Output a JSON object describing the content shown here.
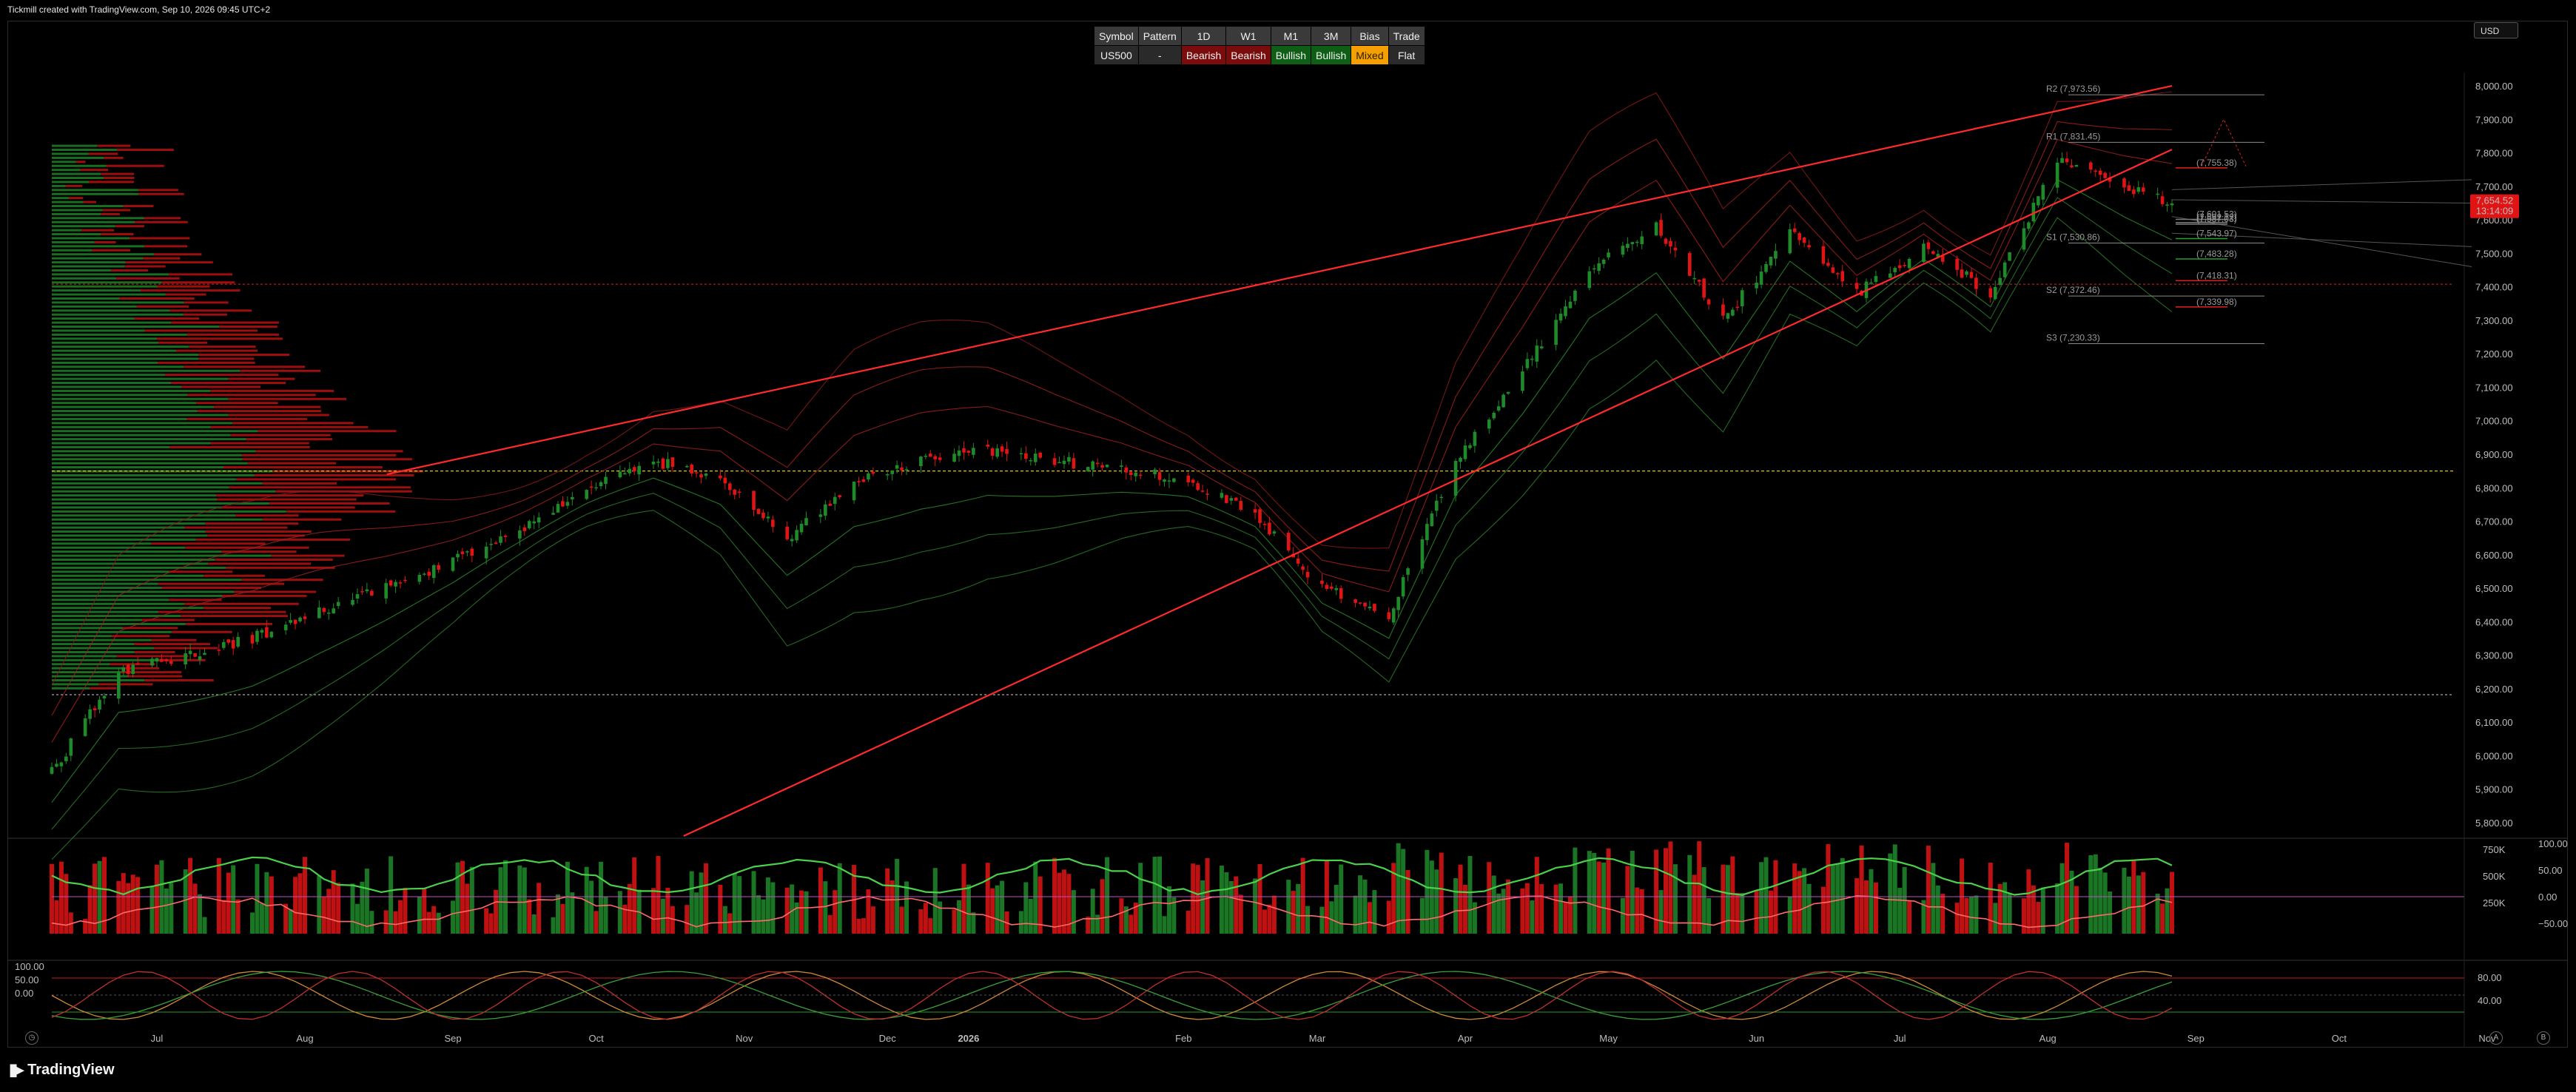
{
  "caption": "Tickmill created with TradingView.com, Sep 10, 2026 09:45 UTC+2",
  "currency": "USD",
  "brand": "TradingView",
  "bias_table": {
    "headers": [
      "Symbol",
      "Pattern",
      "1D",
      "W1",
      "M1",
      "3M",
      "Bias",
      "Trade"
    ],
    "values": [
      "US500",
      "-",
      "Bearish",
      "Bearish",
      "Bullish",
      "Bullish",
      "Mixed",
      "Flat"
    ]
  },
  "colors": {
    "up": "#1f8a2a",
    "down": "#e01414",
    "mixed": "#f5a000",
    "bearish_cell": "#7a0c0c",
    "bullish_cell": "#0e5e16",
    "wedge": "#ff2a2a"
  },
  "chart_data": [
    {
      "type": "candlestick",
      "title": "",
      "ylim": [
        5760,
        8040
      ],
      "y_ticks": [
        "8,000.00",
        "7,900.00",
        "7,800.00",
        "7,700.00",
        "7,600.00",
        "7,500.00",
        "7,400.00",
        "7,300.00",
        "7,200.00",
        "7,100.00",
        "7,000.00",
        "6,900.00",
        "6,800.00",
        "6,700.00",
        "6,600.00",
        "6,500.00",
        "6,400.00",
        "6,300.00",
        "6,200.00",
        "6,100.00",
        "6,000.00",
        "5,900.00",
        "5,800.00"
      ],
      "x_ticks": [
        "Jul",
        "Aug",
        "Sep",
        "Oct",
        "Nov",
        "Dec",
        "2026",
        "Feb",
        "Mar",
        "Apr",
        "May",
        "Jun",
        "Jul",
        "Aug",
        "Sep",
        "Oct",
        "Nov"
      ],
      "price_label": "7,654.52",
      "countdown_label": "13:14:09",
      "pivots": [
        {
          "label": "R2 (7,973.56)",
          "value": 7973.56
        },
        {
          "label": "R1 (7,831.45)",
          "value": 7831.45
        },
        {
          "label": "S1 (7,530.86)",
          "value": 7530.86
        },
        {
          "label": "S2 (7,372.46)",
          "value": 7372.46
        },
        {
          "label": "S3 (7,230.33)",
          "value": 7230.33
        }
      ],
      "levels": [
        {
          "label": "(7,755.38)",
          "value": 7755.38,
          "color": "#e02020"
        },
        {
          "label": "(7,601.53)",
          "value": 7601.53,
          "color": "#7a7a7a"
        },
        {
          "label": "(7,587.03)",
          "value": 7587.03,
          "color": "#7a7a7a"
        },
        {
          "label": "(7,592.12)",
          "value": 7592.12,
          "color": "#7a7a7a"
        },
        {
          "label": "(7,543.97)",
          "value": 7543.97,
          "color": "#22a030"
        },
        {
          "label": "(7,483.28)",
          "value": 7483.28,
          "color": "#22a030"
        },
        {
          "label": "(7,418.31)",
          "value": 7418.31,
          "color": "#e02020"
        },
        {
          "label": "(7,339.98)",
          "value": 7339.98,
          "color": "#e02020"
        }
      ],
      "series": {
        "dates": [
          "2025-06-23",
          "2025-07-07",
          "2025-07-21",
          "2025-08-04",
          "2025-08-18",
          "2025-09-01",
          "2025-09-15",
          "2025-09-29",
          "2025-10-13",
          "2025-10-27",
          "2025-11-10",
          "2025-11-24",
          "2025-12-08",
          "2025-12-22",
          "2026-01-05",
          "2026-01-19",
          "2026-02-02",
          "2026-02-16",
          "2026-03-02",
          "2026-03-16",
          "2026-03-30",
          "2026-04-13",
          "2026-04-27",
          "2026-05-11",
          "2026-05-25",
          "2026-06-08",
          "2026-06-22",
          "2026-07-06",
          "2026-07-20",
          "2026-08-03",
          "2026-08-17",
          "2026-08-31",
          "2026-09-10"
        ],
        "close": [
          5950,
          6250,
          6300,
          6350,
          6430,
          6500,
          6580,
          6680,
          6790,
          6880,
          6830,
          6650,
          6820,
          6880,
          6910,
          6880,
          6860,
          6820,
          6720,
          6500,
          6420,
          6880,
          7150,
          7450,
          7580,
          7300,
          7560,
          7380,
          7520,
          7380,
          7780,
          7700,
          7654
        ]
      },
      "wedge": {
        "upper": [
          [
            0.158,
            6840
          ],
          [
            1.0,
            8000
          ]
        ],
        "lower": [
          [
            0.298,
            5760
          ],
          [
            1.0,
            7810
          ]
        ]
      }
    },
    {
      "type": "bar",
      "title": "",
      "y_ticks_right": [
        "750K",
        "500K",
        "250K"
      ],
      "y_ticks_osc": [
        "100.00",
        "50.00",
        "0.00",
        "−50.00"
      ]
    },
    {
      "type": "line",
      "title": "",
      "y_ticks_left": [
        "100.00",
        "50.00",
        "0.00"
      ],
      "y_ticks_right": [
        "80.00",
        "40.00"
      ]
    }
  ]
}
